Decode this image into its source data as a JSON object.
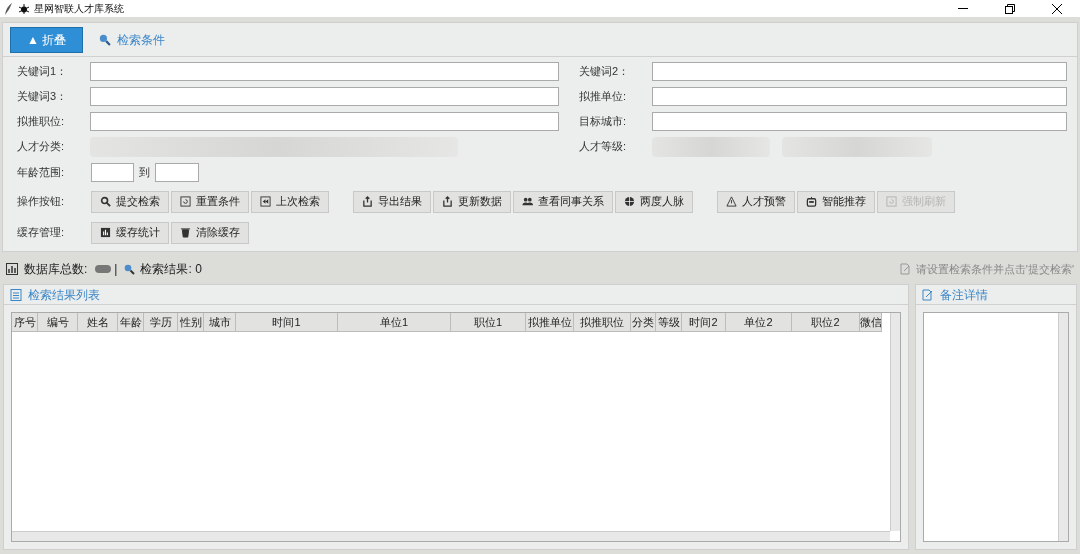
{
  "window": {
    "title": "星网智联人才库系统"
  },
  "toolbar": {
    "collapse_button": "▲ 折叠",
    "section_title": "检索条件"
  },
  "form": {
    "fields": [
      {
        "label": "关键词1：",
        "kind": "text"
      },
      {
        "label": "关键词2：",
        "kind": "text"
      },
      {
        "label": "关键词3：",
        "kind": "text"
      },
      {
        "label": "拟推单位:",
        "kind": "text"
      },
      {
        "label": "拟推职位:",
        "kind": "text"
      },
      {
        "label": "目标城市:",
        "kind": "text"
      },
      {
        "label": "人才分类:",
        "kind": "blurred"
      },
      {
        "label": "人才等级:",
        "kind": "blurred"
      }
    ],
    "age_range": {
      "label": "年龄范围:",
      "separator": "到"
    },
    "action_rows": [
      {
        "label": "操作按钮:",
        "groups": [
          [
            {
              "label": "提交检索",
              "kind": "search",
              "disabled": false
            },
            {
              "label": "重置条件",
              "kind": "reset",
              "disabled": false
            },
            {
              "label": "上次检索",
              "kind": "rewind",
              "disabled": false
            }
          ],
          [
            {
              "label": "导出结果",
              "kind": "export",
              "disabled": false
            },
            {
              "label": "更新数据",
              "kind": "export",
              "disabled": false
            },
            {
              "label": "查看同事关系",
              "kind": "people",
              "disabled": false
            },
            {
              "label": "两度人脉",
              "kind": "globe",
              "disabled": false
            }
          ],
          [
            {
              "label": "人才预警",
              "kind": "warning",
              "disabled": false
            },
            {
              "label": "智能推荐",
              "kind": "robot",
              "disabled": false
            },
            {
              "label": "强制刷新",
              "kind": "reset",
              "disabled": true
            }
          ]
        ]
      },
      {
        "label": "缓存管理:",
        "groups": [
          [
            {
              "label": "缓存统计",
              "kind": "chart",
              "disabled": false
            },
            {
              "label": "清除缓存",
              "kind": "trash",
              "disabled": false
            }
          ]
        ]
      }
    ]
  },
  "status_bar": {
    "db_total_label": "数据库总数:",
    "separator": "|",
    "result_label": "检索结果: 0",
    "hint": "请设置检索条件并点击'提交检索'"
  },
  "results_panel": {
    "title": "检索结果列表",
    "columns": [
      "序号",
      "编号",
      "姓名",
      "年龄",
      "学历",
      "性别",
      "城市",
      "时间1",
      "单位1",
      "职位1",
      "拟推单位",
      "拟推职位",
      "分类",
      "等级",
      "时间2",
      "单位2",
      "职位2",
      "微信"
    ]
  },
  "notes_panel": {
    "title": "备注详情"
  }
}
